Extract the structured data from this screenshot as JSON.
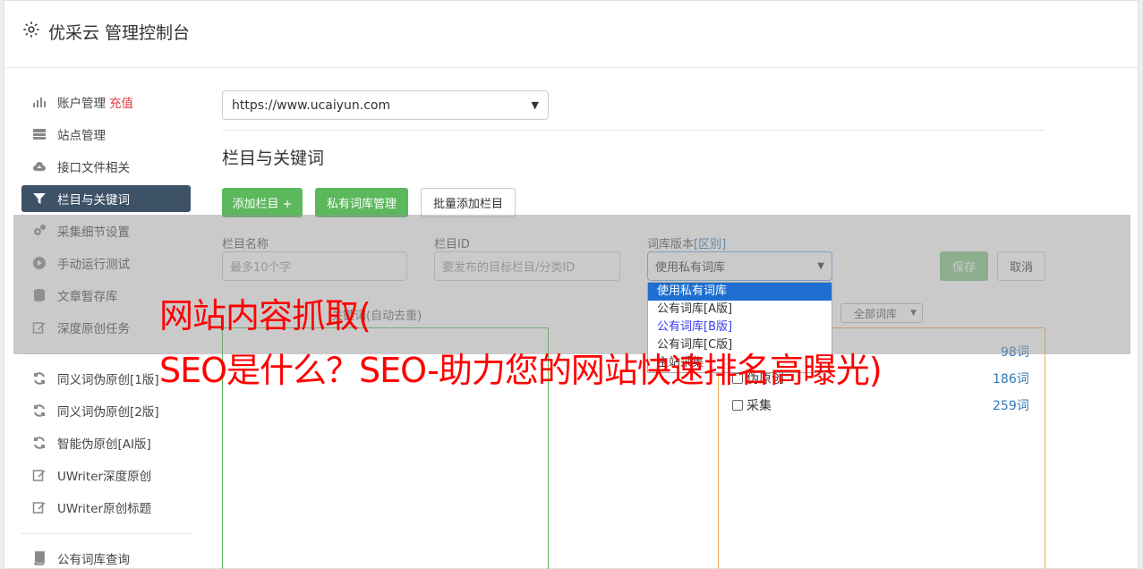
{
  "header": {
    "title": "优采云 管理控制台",
    "icon": "gear-icon"
  },
  "sidebar": {
    "items": [
      {
        "label": "账户管理",
        "badge": "充值",
        "icon": "bar-chart-icon"
      },
      {
        "label": "站点管理",
        "icon": "server-icon"
      },
      {
        "label": "接口文件相关",
        "icon": "cloud-upload-icon"
      },
      {
        "label": "栏目与关键词",
        "icon": "filter-icon",
        "active": true
      },
      {
        "label": "采集细节设置",
        "icon": "cogs-icon"
      },
      {
        "label": "手动运行测试",
        "icon": "play-circle-icon"
      },
      {
        "label": "文章暂存库",
        "icon": "database-icon"
      },
      {
        "label": "深度原创任务",
        "icon": "edit-icon"
      },
      {
        "label": "同义词伪原创[1版]",
        "icon": "refresh-icon"
      },
      {
        "label": "同义词伪原创[2版]",
        "icon": "refresh-icon"
      },
      {
        "label": "智能伪原创[AI版]",
        "icon": "refresh-icon"
      },
      {
        "label": "UWriter深度原创",
        "icon": "edit-icon"
      },
      {
        "label": "UWriter原创标题",
        "icon": "edit-icon"
      },
      {
        "label": "公有词库查询",
        "icon": "book-icon"
      }
    ]
  },
  "main": {
    "site_select": "https://www.ucaiyun.com",
    "section_title": "栏目与关键词",
    "buttons": {
      "add_column": "添加栏目 +",
      "private_lib": "私有词库管理",
      "batch_add": "批量添加栏目"
    },
    "form": {
      "name_label": "栏目名称",
      "name_placeholder": "最多10个字",
      "id_label": "栏目ID",
      "id_placeholder": "要发布的目标栏目/分类ID",
      "lib_label": "词库版本",
      "lib_link": "[区别]",
      "lib_value": "使用私有词库",
      "lib_options": [
        "使用私有词库",
        "公有词库[A版]",
        "公有词库[B版]",
        "公有词库[C版]",
        "主站采集"
      ],
      "save": "保存",
      "cancel": "取消"
    },
    "keywords_label": "关键词(自动去重)",
    "all_lib": "全部词库",
    "lib_list": [
      {
        "label": "",
        "count": "98词"
      },
      {
        "label": "伪原创",
        "count": "186词"
      },
      {
        "label": "采集",
        "count": "259词"
      }
    ]
  },
  "watermark": {
    "line1": "网站内容抓取(",
    "line2": "SEO是什么？SEO-助力您的网站快速排名高曝光)"
  },
  "colors": {
    "accent": "#3d5167",
    "green": "#5cb85c",
    "red": "#ff0000",
    "link": "#337ab7"
  }
}
